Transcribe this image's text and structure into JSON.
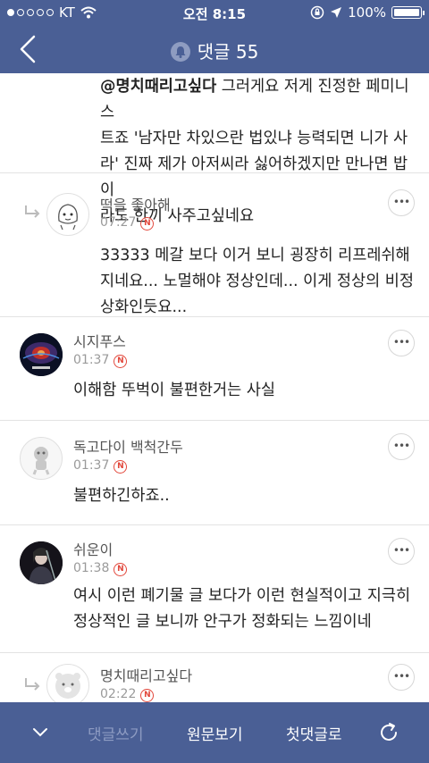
{
  "status": {
    "carrier": "KT",
    "time": "오전 8:15",
    "battery": "100%"
  },
  "nav": {
    "title": "댓글 55"
  },
  "comments": [
    {
      "mention": "@명치때리고싶다",
      "lines": [
        "  그러게요 저게 진정한 페미니스",
        "트죠 '남자만 차있으란 법있냐 능력되면 니가 사",
        "라' 진짜 제가 아저씨라 싫어하겠지만 만나면 밥이",
        "라도 한끼 사주고싶네요"
      ]
    },
    {
      "name": "떡을 좋아해",
      "time": "07:27",
      "badge": "N",
      "lines": [
        "33333 메갈 보다 이거 보니 굉장히 리프레쉬해",
        "지네요...  노멀해야 정상인데... 이게 정상의 비정",
        "상화인듯요..."
      ]
    },
    {
      "name": "시지푸스",
      "time": "01:37",
      "badge": "N",
      "lines": [
        "이해함 뚜벅이 불편한거는 사실"
      ]
    },
    {
      "name": "독고다이 백척간두",
      "time": "01:37",
      "badge": "N",
      "lines": [
        "불편하긴하죠.."
      ]
    },
    {
      "name": "쉬운이",
      "time": "01:38",
      "badge": "N",
      "lines": [
        "여시 이런 폐기물 글 보다가 이런 현실적이고 지극히",
        "정상적인 글 보니까 안구가 정화되는 느낌이네"
      ]
    },
    {
      "name": "명치때리고싶다",
      "time": "02:22",
      "badge": "N",
      "lines": []
    }
  ],
  "more_label": "•••",
  "bottom": {
    "write": "댓글쓰기",
    "original": "원문보기",
    "first": "첫댓글로"
  },
  "colors": {
    "bar": "#4a5f95",
    "badge": "#e2473b"
  }
}
